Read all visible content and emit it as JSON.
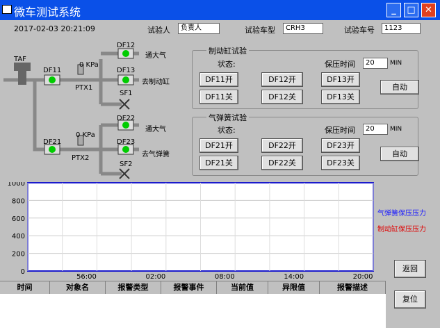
{
  "window": {
    "title": "微车测试系统"
  },
  "header": {
    "datetime": "2017-02-03 20:21:09",
    "tester_label": "试验人",
    "tester_value": "负责人",
    "model_label": "试验车型",
    "model_value": "CRH3",
    "carno_label": "试验车号",
    "carno_value": "1123"
  },
  "diagram": {
    "taf": "TAF",
    "df11": "DF11",
    "df12": "DF12",
    "df13": "DF13",
    "sf1": "SF1",
    "df21": "DF21",
    "df22": "DF22",
    "df23": "DF23",
    "sf2": "SF2",
    "ptx1": "PTX1",
    "ptx2": "PTX2",
    "p1": "0 KPa",
    "p2": "0 KPa",
    "to_air1": "通大气",
    "to_brake": "去制动缸",
    "to_air2": "通大气",
    "to_spring": "去气弹簧"
  },
  "brake": {
    "title": "制动缸试验",
    "status_label": "状态:",
    "hold_label": "保压时间",
    "hold_value": "20",
    "unit": "MIN",
    "btn_df11_open": "DF11开",
    "btn_df12_open": "DF12开",
    "btn_df13_open": "DF13开",
    "btn_df11_close": "DF11关",
    "btn_df12_close": "DF12关",
    "btn_df13_close": "DF13关",
    "auto": "自动"
  },
  "spring": {
    "title": "气弹簧试验",
    "status_label": "状态:",
    "hold_label": "保压时间",
    "hold_value": "20",
    "unit": "MIN",
    "btn_df21_open": "DF21开",
    "btn_df22_open": "DF22开",
    "btn_df23_open": "DF23开",
    "btn_df21_close": "DF21关",
    "btn_df22_close": "DF22关",
    "btn_df23_close": "DF23关",
    "auto": "自动"
  },
  "chart_data": {
    "type": "line",
    "ylim": [
      0,
      1000
    ],
    "yticks": [
      "1000",
      "800",
      "600",
      "400",
      "200",
      "0"
    ],
    "xticks": [
      "56:00",
      "02:00",
      "08:00",
      "14:00",
      "20:00"
    ],
    "series": [
      {
        "name": "气弹簧保压压力",
        "color": "#1a1aff",
        "values": []
      },
      {
        "name": "制动缸保压压力",
        "color": "#e00000",
        "values": []
      }
    ]
  },
  "actions": {
    "back": "返回",
    "reset": "复位"
  },
  "alarm_table": {
    "columns": [
      "时间",
      "对象名",
      "报警类型",
      "报警事件",
      "当前值",
      "异限值",
      "报警描述"
    ]
  }
}
